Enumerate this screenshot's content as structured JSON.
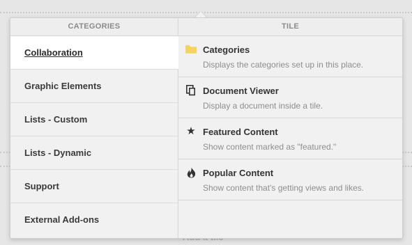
{
  "categories_panel": {
    "header": "CATEGORIES",
    "items": [
      {
        "label": "Collaboration"
      },
      {
        "label": "Graphic Elements"
      },
      {
        "label": "Lists - Custom"
      },
      {
        "label": "Lists - Dynamic"
      },
      {
        "label": "Support"
      },
      {
        "label": "External Add-ons"
      }
    ],
    "selected": "Collaboration"
  },
  "tile_panel": {
    "header": "TILE",
    "items": [
      {
        "title": "Categories",
        "description": "Displays the categories set up in this place.",
        "icon": "folder-icon"
      },
      {
        "title": "Document Viewer",
        "description": "Display a document inside a tile.",
        "icon": "document-icon"
      },
      {
        "title": "Featured Content",
        "description": "Show content marked as \"featured.\"",
        "icon": "star-icon"
      },
      {
        "title": "Popular Content",
        "description": "Show content that's getting views and likes.",
        "icon": "flame-icon"
      }
    ]
  },
  "background": {
    "add_tile_text": "Add a tile"
  },
  "colors": {
    "panel_bg": "#f1f1f1",
    "selected_bg": "#ffffff",
    "folder_icon": "#f4d35e"
  }
}
